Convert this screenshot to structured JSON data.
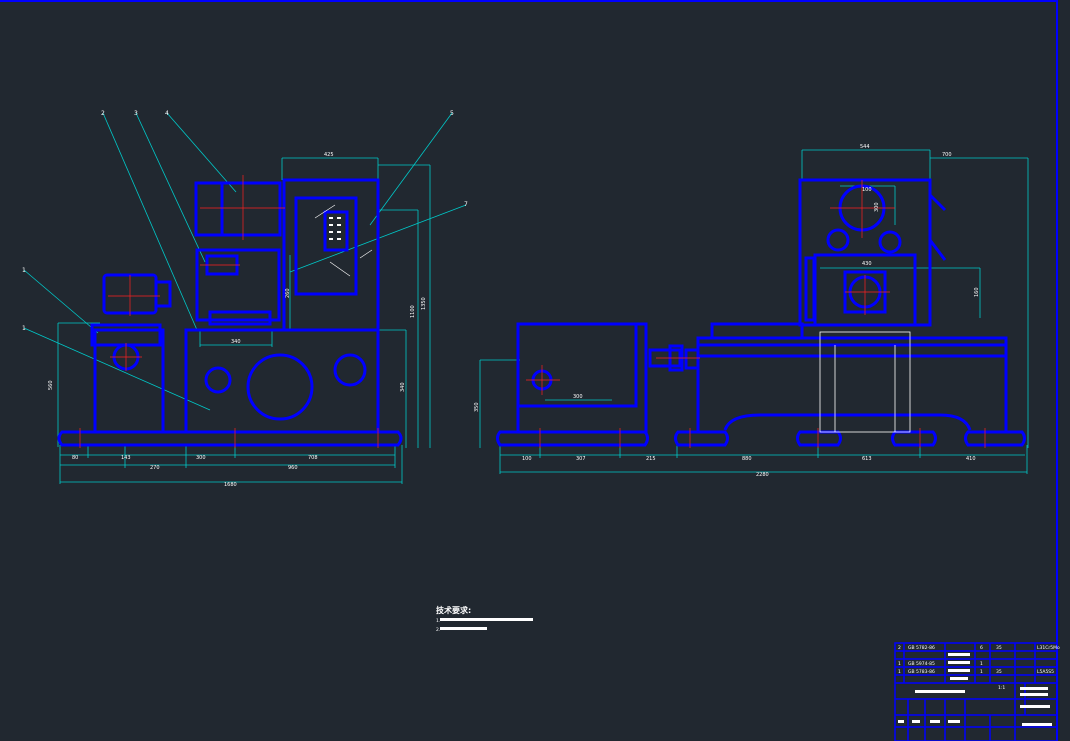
{
  "colors": {
    "background": "#212830",
    "outline": "#0000ff",
    "dimension": "#00c8c8",
    "centerline": "#ff2020",
    "hidden": "#ffffff"
  },
  "front_view": {
    "balloons": [
      "1",
      "1",
      "2",
      "3",
      "4",
      "5",
      "7"
    ],
    "dims": {
      "top_width": "425",
      "height_right": "1350",
      "height_right2": "1100",
      "right_340": "340",
      "box_h": "260",
      "left_h": "560",
      "inner_w": "340",
      "b_80": "80",
      "b_143": "143",
      "b_270": "270",
      "b_300": "300",
      "b_708": "708",
      "b_960": "960",
      "total": "1680"
    }
  },
  "side_view": {
    "dims": {
      "top_544": "544",
      "top_700": "700",
      "d_100": "100",
      "h_300": "300",
      "w_430": "430",
      "h_160": "160",
      "left_h": "350",
      "inner_300": "300",
      "b_100": "100",
      "b_307": "307",
      "b_215": "215",
      "b_880": "880",
      "b_613": "613",
      "b_410": "410",
      "total": "2280"
    }
  },
  "notes": {
    "title": "技术要求:",
    "line1": "1.",
    "line2": "2."
  },
  "title_block": {
    "r1": [
      "2",
      "GB 5782-86",
      "6",
      "35",
      "L31Cr5Mo"
    ],
    "r2": [
      "1",
      "GB 5974-85",
      "1",
      "",
      ""
    ],
    "r3": [
      "1",
      "GB 5783-86",
      "1",
      "35",
      "L5A5S5"
    ],
    "scale": "1:1"
  }
}
